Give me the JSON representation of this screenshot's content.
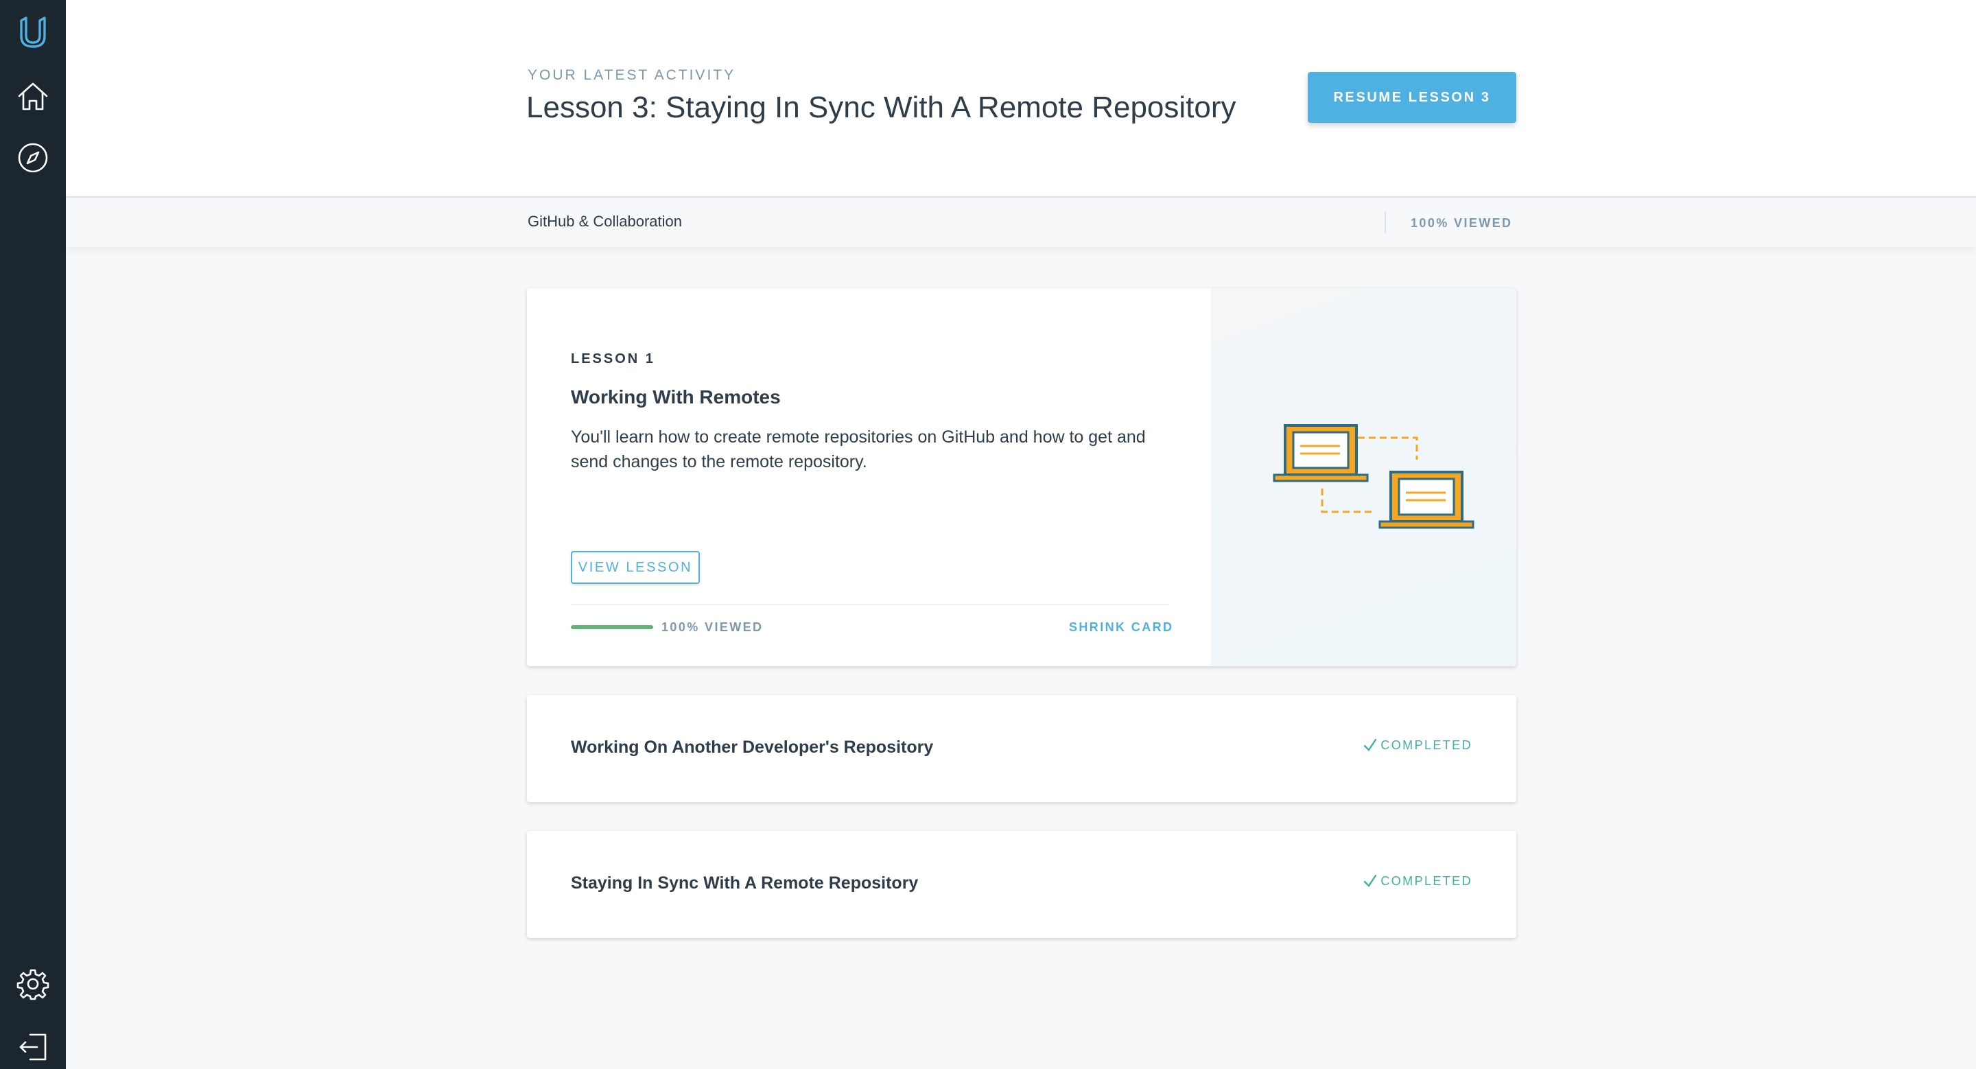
{
  "sidebar": {
    "icons": [
      "udacity-logo-icon",
      "home-icon",
      "compass-icon",
      "gear-icon",
      "logout-icon"
    ]
  },
  "header": {
    "eyebrow": "YOUR LATEST ACTIVITY",
    "title": "Lesson 3: Staying In Sync With A Remote Repository",
    "resume_label": "RESUME LESSON 3"
  },
  "subbar": {
    "course_name": "GitHub & Collaboration",
    "progress": "100% VIEWED"
  },
  "lessons": [
    {
      "label": "LESSON 1",
      "title": "Working With Remotes",
      "description": "You'll learn how to create remote repositories on GitHub and how to get and send changes to the remote repository.",
      "button_label": "VIEW LESSON",
      "progress_fraction": 1.0,
      "progress_text": "100% VIEWED",
      "shrink_label": "SHRINK CARD"
    },
    {
      "title": "Working On Another Developer's Repository",
      "status": "COMPLETED"
    },
    {
      "title": "Staying In Sync With A Remote Repository",
      "status": "COMPLETED"
    }
  ],
  "colors": {
    "sidebar_bg": "#1c262f",
    "accent_blue": "#4fb0e2",
    "progress_green": "#62b47a",
    "completed_teal": "#3fb0a0",
    "illustration_orange": "#f5a623"
  }
}
